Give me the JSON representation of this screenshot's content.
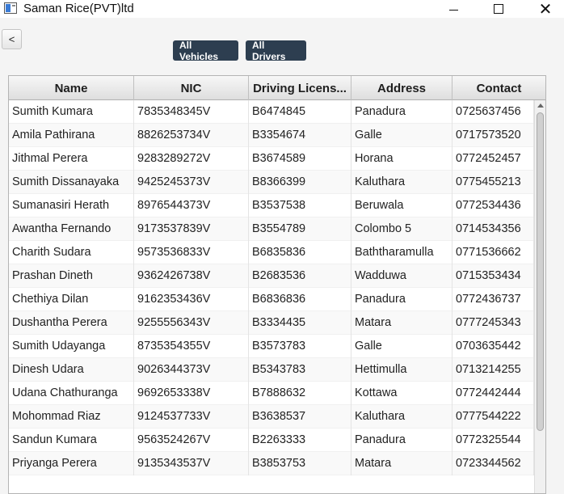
{
  "window": {
    "title": "Saman Rice(PVT)ltd",
    "icons": [
      "app-icon",
      "minimize-icon",
      "maximize-icon",
      "close-icon"
    ]
  },
  "toolbar": {
    "back_label": "<",
    "all_vehicles_label": "All Vehicles",
    "all_drivers_label": "All Drivers"
  },
  "colors": {
    "nav_button_bg": "#2d3e50",
    "nav_button_text": "#ffffff"
  },
  "table": {
    "columns": [
      "Name",
      "NIC",
      "Driving Licens...",
      "Address",
      "Contact"
    ],
    "rows": [
      [
        "Sumith Kumara",
        "7835348345V",
        "B6474845",
        "Panadura",
        "0725637456"
      ],
      [
        "Amila Pathirana",
        "8826253734V",
        "B3354674",
        "Galle",
        "0717573520"
      ],
      [
        "Jithmal Perera",
        "9283289272V",
        "B3674589",
        "Horana",
        "0772452457"
      ],
      [
        "Sumith Dissanayaka",
        "9425245373V",
        "B8366399",
        "Kaluthara",
        "0775455213"
      ],
      [
        "Sumanasiri Herath",
        "8976544373V",
        "B3537538",
        "Beruwala",
        "0772534436"
      ],
      [
        "Awantha Fernando",
        "9173537839V",
        "B3554789",
        "Colombo 5",
        "0714534356"
      ],
      [
        "Charith Sudara",
        "9573536833V",
        "B6835836",
        "Baththaramulla",
        "0771536662"
      ],
      [
        "Prashan Dineth",
        "9362426738V",
        "B2683536",
        "Wadduwa",
        "0715353434"
      ],
      [
        "Chethiya Dilan",
        "9162353436V",
        "B6836836",
        "Panadura",
        "0772436737"
      ],
      [
        "Dushantha Perera",
        "9255556343V",
        "B3334435",
        "Matara",
        "0777245343"
      ],
      [
        "Sumith Udayanga",
        "8735354355V",
        "B3573783",
        "Galle",
        "0703635442"
      ],
      [
        "Dinesh Udara",
        "9026344373V",
        "B5343783",
        "Hettimulla",
        "0713214255"
      ],
      [
        "Udana Chathuranga",
        "9692653338V",
        "B7888632",
        "Kottawa",
        "0772442444"
      ],
      [
        "Mohommad Riaz",
        "9124537733V",
        "B3638537",
        "Kaluthara",
        "0777544222"
      ],
      [
        "Sandun Kumara",
        "9563524267V",
        "B2263333",
        "Panadura",
        "0772325544"
      ],
      [
        "Priyanga Perera",
        "9135343537V",
        "B3853753",
        "Matara",
        "0723344562"
      ]
    ]
  }
}
